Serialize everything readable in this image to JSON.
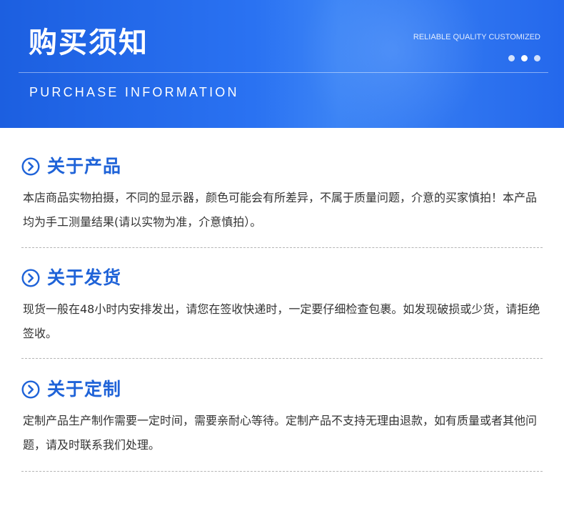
{
  "banner": {
    "title": "购买须知",
    "tagline": "RELIABLE QUALITY  CUSTOMIZED",
    "subtitle": "PURCHASE INFORMATION"
  },
  "sections": [
    {
      "title": "关于产品",
      "body": "本店商品实物拍摄，不同的显示器，颜色可能会有所差异，不属于质量问题，介意的买家慎拍！本产品均为手工测量结果(请以实物为准，介意慎拍）。"
    },
    {
      "title": "关于发货",
      "body": "现货一般在48小时内安排发出，请您在签收快递时，一定要仔细检查包裹。如发现破损或少货，请拒绝签收。"
    },
    {
      "title": "关于定制",
      "body": "定制产品生产制作需要一定时间，需要亲耐心等待。定制产品不支持无理由退款，如有质量或者其他问题，请及时联系我们处理。"
    }
  ],
  "colors": {
    "accent": "#1f63d8",
    "banner": "#2a72f2",
    "text": "#333333"
  }
}
